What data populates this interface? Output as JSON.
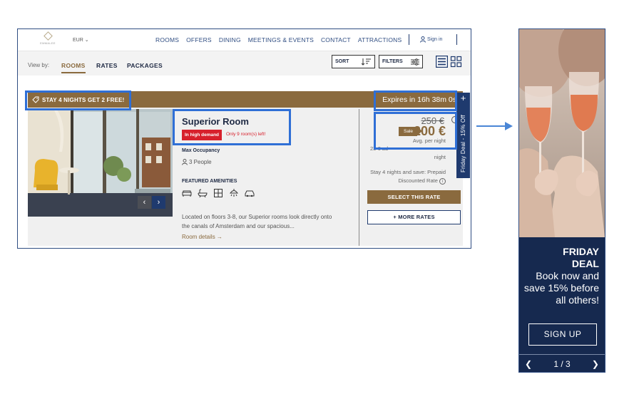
{
  "header": {
    "logo_text": "EMMALEE",
    "currency": "EUR",
    "nav": [
      "ROOMS",
      "OFFERS",
      "DINING",
      "MEETINGS & EVENTS",
      "CONTACT",
      "ATTRACTIONS"
    ],
    "sign_in": "Sign in"
  },
  "viewbar": {
    "label": "View by:",
    "tabs": [
      "ROOMS",
      "RATES",
      "PACKAGES"
    ],
    "active_tab": "ROOMS",
    "sort": "SORT",
    "filters": "FILTERS"
  },
  "promo": {
    "text": "STAY 4 NIGHTS GET 2 FREE!",
    "expires": "Expires in 16h 38m 0s"
  },
  "room": {
    "title": "Superior Room",
    "demand_badge": "In high demand",
    "rooms_left": "Only 9 room(s) left!",
    "max_occupancy_label": "Max Occupancy",
    "people": "3 People",
    "amenities_heading": "FEATURED AMENITIES",
    "amenity_icons": [
      "sofa-icon",
      "bathtub-icon",
      "window-icon",
      "shower-icon",
      "car-icon"
    ],
    "description": "Located on floors 3-8, our Superior rooms look directly onto the canals of Amsterdam and our spacious...",
    "details_link": "Room details →"
  },
  "pricing": {
    "old_price": "250 €",
    "sale_label": "Sale",
    "price": "200 €",
    "avg_per_night": "Avg. per night",
    "extra_fee": "23 € ad",
    "night_word": "night",
    "rate_note": "Stay 4 nights and save: Prepaid Discounted Rate",
    "select_button": "SELECT THIS RATE",
    "more_rates_button": "+ MORE RATES"
  },
  "side_tab": {
    "plus": "+",
    "label": "Friday Deal - 15% Off"
  },
  "banner": {
    "title_line1": "FRIDAY",
    "title_line2": "DEAL",
    "body": "Book now and save 15% before all others!",
    "button": "SIGN UP",
    "counter": "1 / 3"
  },
  "colors": {
    "navy": "#1f3a6e",
    "gold": "#8a6a3e",
    "red": "#d7202c",
    "highlight": "#2f6fd6"
  }
}
